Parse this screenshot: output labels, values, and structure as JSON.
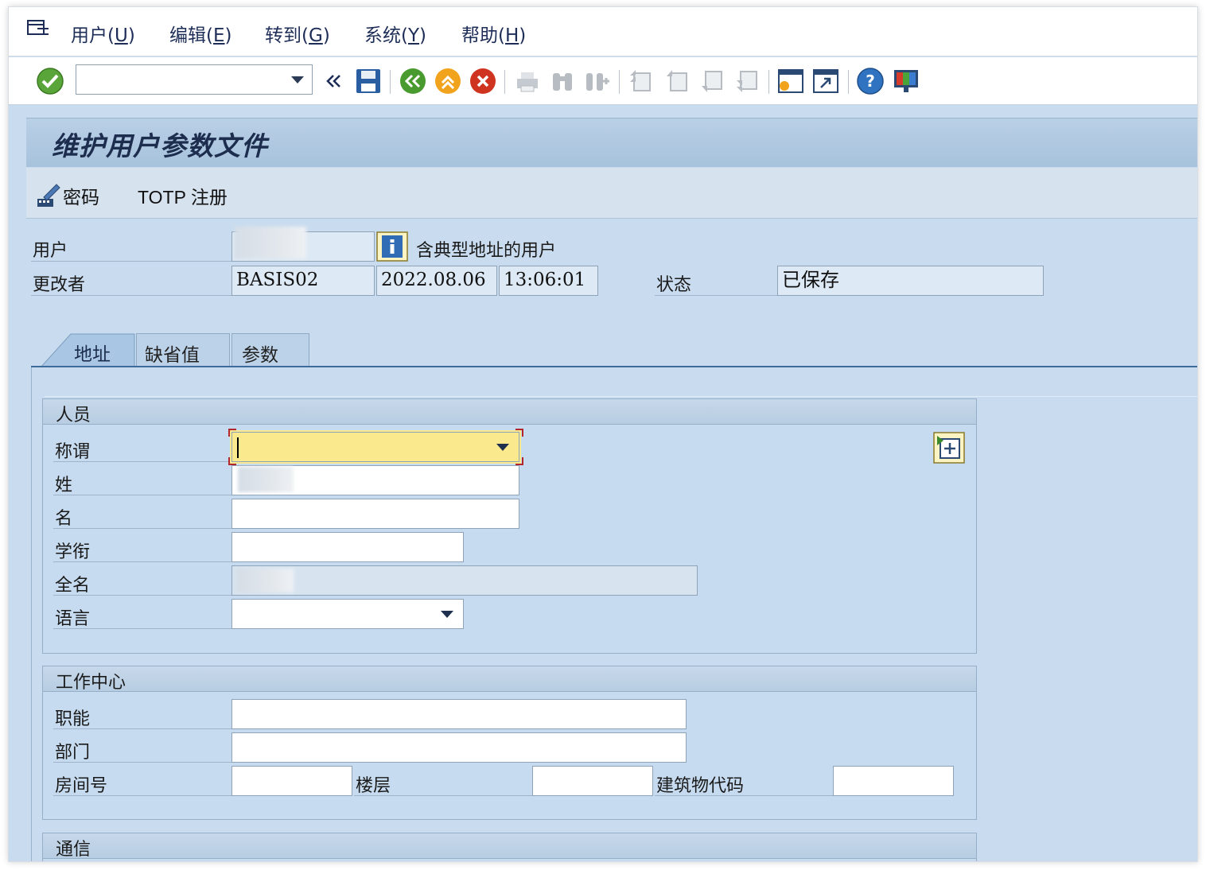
{
  "menu": {
    "items": [
      {
        "label": "用户(",
        "key": "U",
        "after": ")"
      },
      {
        "label": "编辑(",
        "key": "E",
        "after": ")"
      },
      {
        "label": "转到(",
        "key": "G",
        "after": ")"
      },
      {
        "label": "系统(",
        "key": "Y",
        "after": ")"
      },
      {
        "label": "帮助(",
        "key": "H",
        "after": ")"
      }
    ]
  },
  "toolbar": {
    "command_field": "",
    "icons": [
      "enter-check-icon",
      "nav-back-icon",
      "save-icon",
      "back-icon",
      "exit-icon",
      "cancel-icon",
      "print-icon",
      "find-icon",
      "find-next-icon",
      "first-page-icon",
      "previous-page-icon",
      "next-page-icon",
      "last-page-icon",
      "create-session-icon",
      "shortcut-icon",
      "help-icon",
      "customize-layout-icon"
    ]
  },
  "page": {
    "title": "维护用户参数文件"
  },
  "app_toolbar": {
    "password_label": "密码",
    "totp_label": "TOTP 注册"
  },
  "header": {
    "user_label": "用户",
    "user_value": "",
    "user_type_text": "含典型地址的用户",
    "changed_by_label": "更改者",
    "changed_by_value": "BASIS02",
    "date_value": "2022.08.06",
    "time_value": "13:06:01",
    "status_label": "状态",
    "status_value": "已保存"
  },
  "tabs": [
    {
      "label": "地址",
      "active": true
    },
    {
      "label": "缺省值",
      "active": false
    },
    {
      "label": "参数",
      "active": false
    }
  ],
  "person": {
    "group_title": "人员",
    "title_label": "称谓",
    "title_value": "",
    "lastname_label": "姓",
    "firstname_label": "名",
    "academic_label": "学衔",
    "fullname_label": "全名",
    "language_label": "语言"
  },
  "workcenter": {
    "group_title": "工作中心",
    "function_label": "职能",
    "department_label": "部门",
    "room_label": "房间号",
    "floor_label": "楼层",
    "building_label": "建筑物代码"
  },
  "communication": {
    "group_title": "通信"
  }
}
